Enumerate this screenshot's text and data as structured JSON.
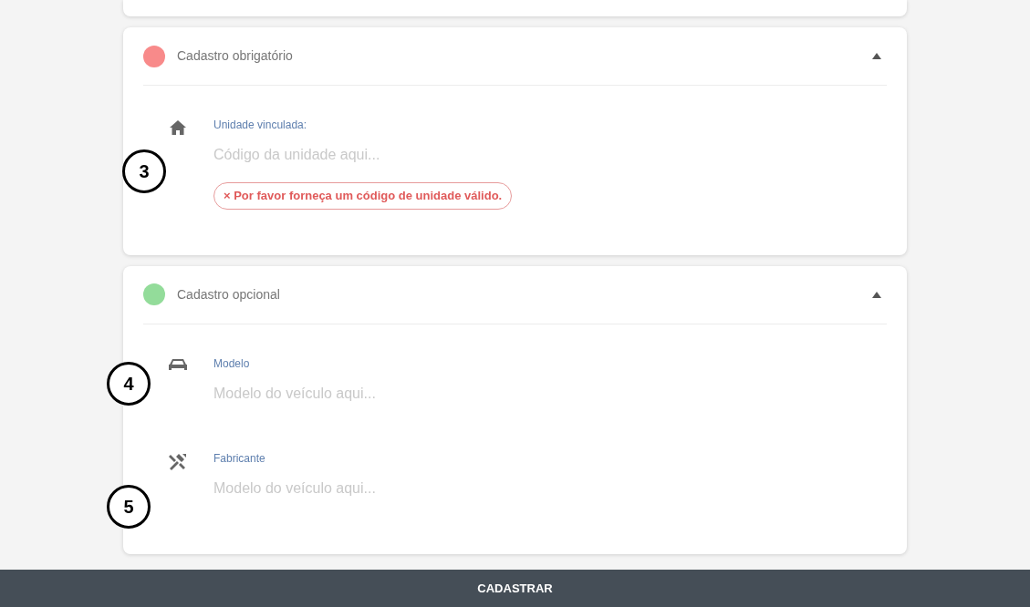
{
  "sections": [
    {
      "title": "Cadastro obrigatório",
      "color": "#f88a8a",
      "expanded": true,
      "fields": [
        {
          "label": "Unidade vinculada:",
          "placeholder": "Código da unidade aqui...",
          "error": "× Por favor forneça um código de unidade válido."
        }
      ]
    },
    {
      "title": "Cadastro opcional",
      "color": "#93dc9a",
      "expanded": true,
      "fields": [
        {
          "label": "Modelo",
          "placeholder": "Modelo do veículo aqui..."
        },
        {
          "label": "Fabricante",
          "placeholder": "Modelo do veículo aqui..."
        }
      ]
    }
  ],
  "annotations": [
    "3",
    "4",
    "5"
  ],
  "submit_button": "CADASTRAR"
}
